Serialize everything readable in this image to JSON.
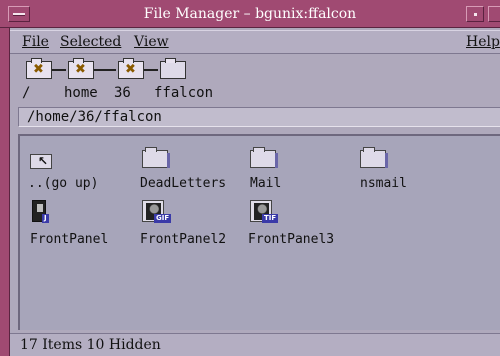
{
  "window": {
    "title": "File Manager – bgunix:ffalcon"
  },
  "menubar": {
    "file": "File",
    "selected": "Selected",
    "view": "View",
    "help": "Help"
  },
  "pathbar": {
    "segments": [
      "/",
      "home",
      "36",
      "ffalcon"
    ],
    "icon_glyph": "✖"
  },
  "location": {
    "value": "/home/36/ffalcon"
  },
  "files": [
    {
      "name": "..(go up)",
      "kind": "go-up"
    },
    {
      "name": "DeadLetters",
      "kind": "folder"
    },
    {
      "name": "Mail",
      "kind": "folder"
    },
    {
      "name": "nsmail",
      "kind": "folder"
    },
    {
      "name": "FrontPanel",
      "kind": "app",
      "badge": "J"
    },
    {
      "name": "FrontPanel2",
      "kind": "image",
      "badge": "GIF"
    },
    {
      "name": "FrontPanel3",
      "kind": "image",
      "badge": "TIF"
    }
  ],
  "status": {
    "text": "17 Items 10 Hidden"
  },
  "colors": {
    "titlebar": "#A04A72",
    "window_bg": "#AFA9BC",
    "file_pane": "#A7A5BA",
    "badge": "#3a3aa8"
  }
}
